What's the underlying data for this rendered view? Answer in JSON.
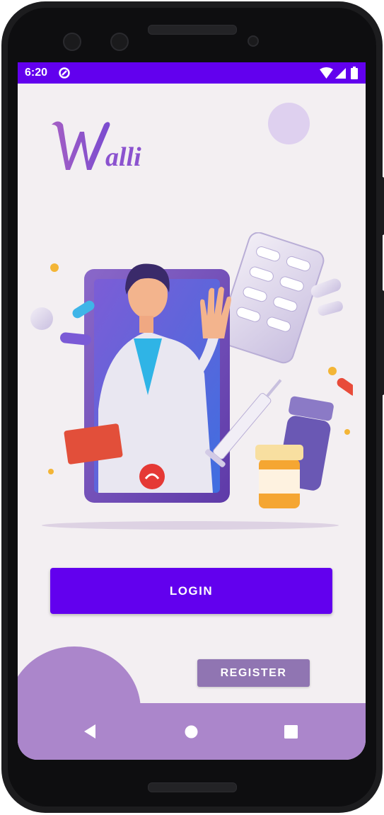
{
  "status_bar": {
    "time": "6:20"
  },
  "app": {
    "logo_text": "Walli"
  },
  "actions": {
    "login_label": "LOGIN",
    "register_label": "REGISTER"
  },
  "colors": {
    "primary": "#6200ee",
    "accent": "#ab86cb",
    "register": "#9075b2",
    "background": "#f3eff2"
  }
}
